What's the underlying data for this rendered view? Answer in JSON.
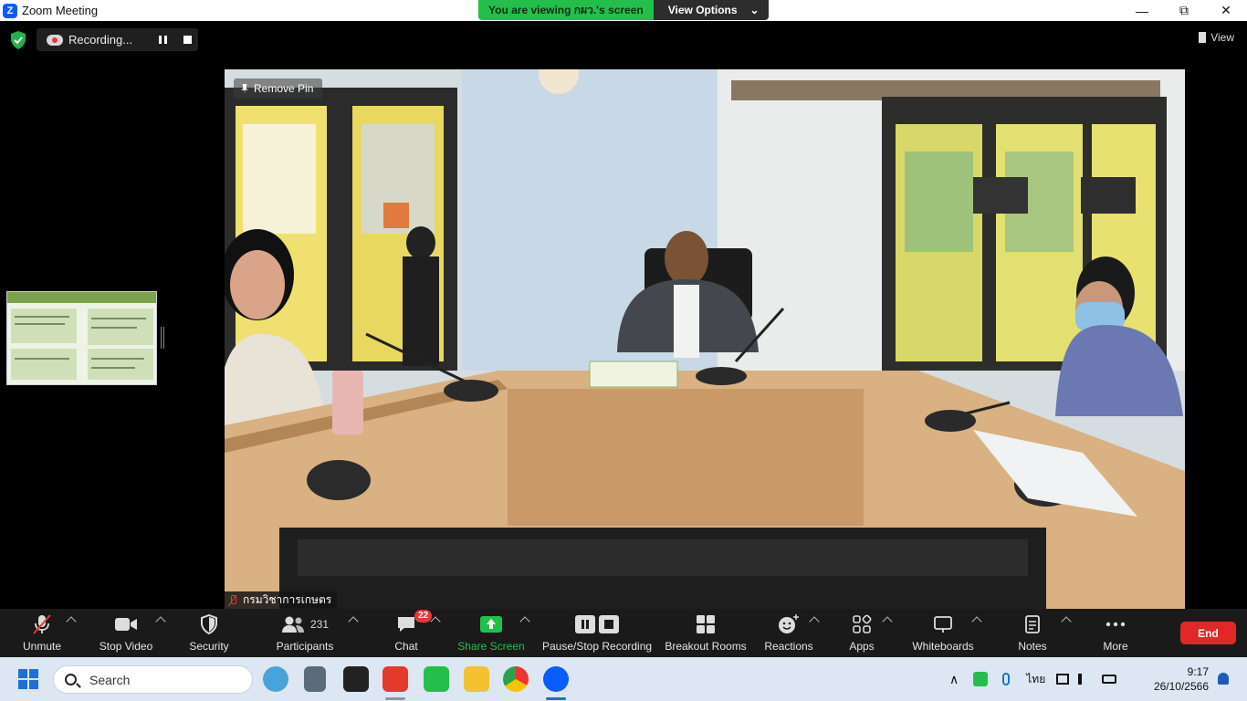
{
  "window": {
    "title": "Zoom Meeting",
    "minimize": "—",
    "maximize": "⧉",
    "close": "✕"
  },
  "banner": {
    "text": "You are viewing กผว.'s screen",
    "options_label": "View Options",
    "options_caret": "⌄"
  },
  "recording": {
    "label": "Recording..."
  },
  "view_button": {
    "label": "View"
  },
  "video": {
    "pin_label": "Remove Pin",
    "speaker_name": "กรมวิชาการเกษตร"
  },
  "toolbar": {
    "unmute": "Unmute",
    "stop_video": "Stop Video",
    "security": "Security",
    "participants": "Participants",
    "participants_count": "231",
    "chat": "Chat",
    "chat_badge": "22",
    "share_screen": "Share Screen",
    "pause_stop_recording": "Pause/Stop Recording",
    "breakout_rooms": "Breakout Rooms",
    "reactions": "Reactions",
    "apps": "Apps",
    "whiteboards": "Whiteboards",
    "notes": "Notes",
    "more": "More",
    "end": "End"
  },
  "taskbar": {
    "search_placeholder": "Search",
    "language": "ไทย",
    "time": "9:17",
    "date": "26/10/2566"
  },
  "colors": {
    "share_green": "#22c04a",
    "end_red": "#e02828",
    "zoom_blue": "#0b5cff"
  }
}
